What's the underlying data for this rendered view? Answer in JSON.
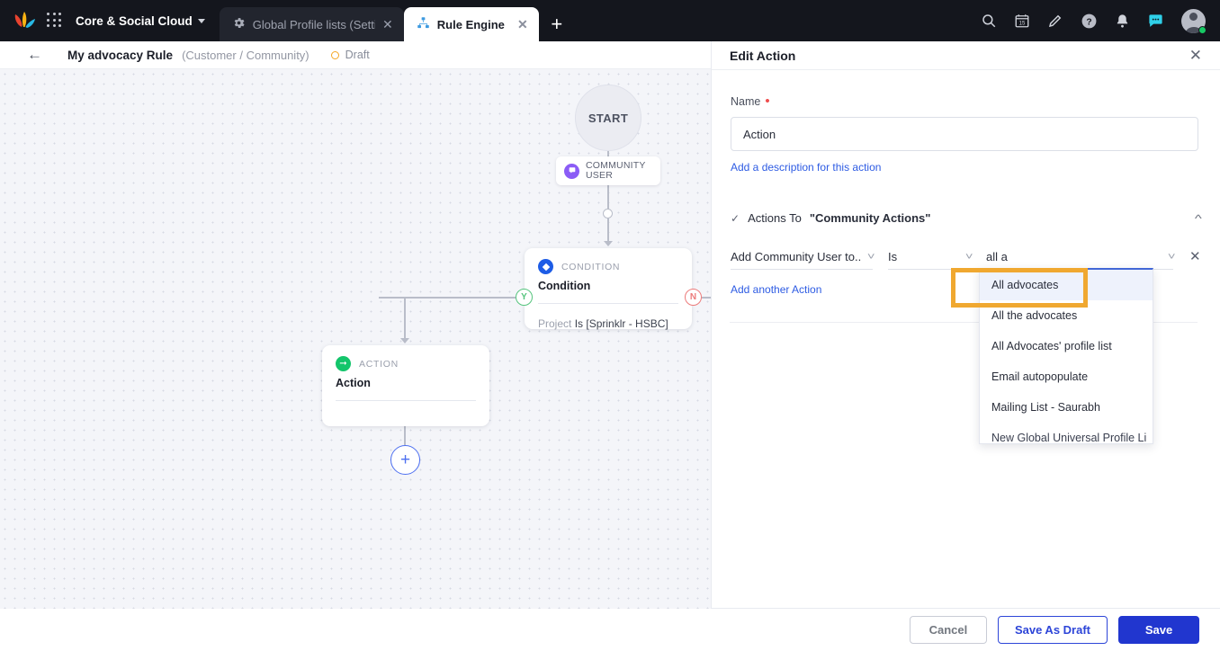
{
  "topbar": {
    "logo": "sprinklr-logo",
    "app_grid_icon": "app-grid-icon",
    "workspace": "Core & Social Cloud",
    "tabs": [
      {
        "label": "Global Profile lists (Setti",
        "icon": "gear-icon",
        "active": false
      },
      {
        "label": "Rule Engine",
        "icon": "hierarchy-icon",
        "active": true
      }
    ],
    "new_tab_label": "+",
    "icons": [
      "search-icon",
      "calendar-icon",
      "pencil-icon",
      "help-icon",
      "bell-icon",
      "chat-icon",
      "avatar"
    ],
    "calendar_day": "15",
    "status_color": "#17c964"
  },
  "subheader": {
    "back_label": "←",
    "rule_name": "My advocacy Rule",
    "rule_scope": "(Customer / Community)",
    "status": "Draft",
    "status_color": "#f5a623"
  },
  "canvas": {
    "start_label": "START",
    "trigger_chip": "COMMUNITY USER",
    "condition": {
      "kind": "CONDITION",
      "title": "Condition",
      "rule_prefix": "Project",
      "rule_expr": "Is [Sprinklr - HSBC]"
    },
    "action": {
      "kind": "ACTION",
      "title": "Action"
    },
    "yes_label": "Y",
    "no_label": "N",
    "add_node_label": "+"
  },
  "panel": {
    "title": "Edit Action",
    "close_label": "✕",
    "name_label": "Name",
    "name_value": "Action",
    "name_placeholder": "Action",
    "add_description_link": "Add a description for this action",
    "section": {
      "check": "✓",
      "prefix": "Actions To ",
      "quoted": "\"Community Actions\"",
      "collapse_icon": "chevron-up-icon"
    },
    "row": {
      "action_select": "Add Community User to...",
      "operator_select": "Is",
      "value_select": "all a",
      "remove_label": "✕"
    },
    "add_another_link": "Add another Action",
    "dropdown": {
      "options": [
        "All advocates",
        "All the advocates",
        "All Advocates' profile list",
        "Email autopopulate",
        "Mailing List - Saurabh",
        "New Global Universal Profile Li"
      ],
      "selected_index": 0,
      "highlight_color": "#f0a830"
    }
  },
  "footer": {
    "cancel": "Cancel",
    "save_as_draft": "Save As Draft",
    "save": "Save",
    "accent": "#2136cf"
  }
}
